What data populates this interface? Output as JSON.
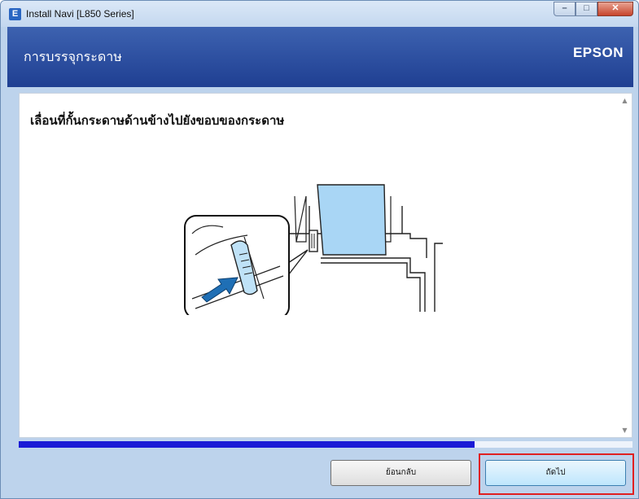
{
  "window": {
    "title": "Install Navi [L850 Series]",
    "icon_letter": "E",
    "controls": {
      "minimize": "–",
      "maximize": "□",
      "close": "✕"
    }
  },
  "header": {
    "title": "การบรรจุกระดาษ",
    "brand": "EPSON"
  },
  "content": {
    "instruction": "เลื่อนที่กั้นกระดาษด้านข้างไปยังขอบของกระดาษ",
    "illustration": "printer-paper-edge-guide-illustration"
  },
  "progress": {
    "fraction": 0.743
  },
  "buttons": {
    "back": "ย้อนกลับ",
    "next": "ถัดไป"
  },
  "colors": {
    "header": "#2a4ea3",
    "progress": "#1a1ad6",
    "highlight": "#e02020",
    "paper": "#a9d6f5",
    "arrow": "#1f6fb5"
  }
}
